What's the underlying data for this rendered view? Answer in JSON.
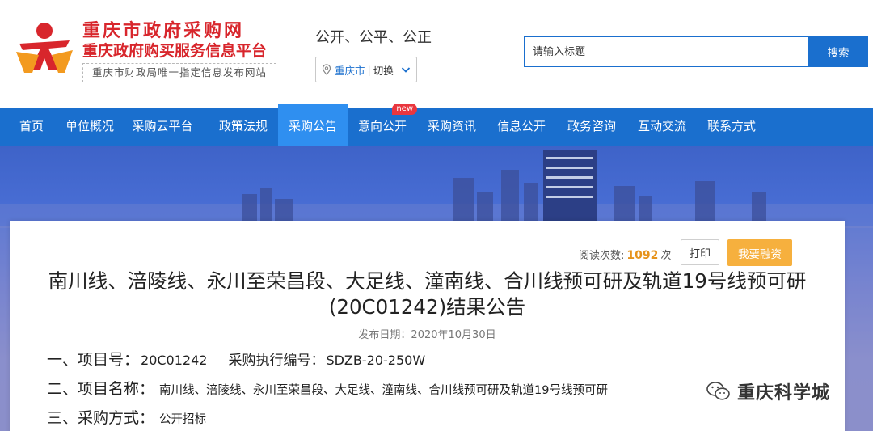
{
  "header": {
    "site_title": "重庆市政府采购网",
    "site_subtitle": "重庆政府购买服务信息平台",
    "site_note": "重庆市财政局唯一指定信息发布网站",
    "slogan": "公开、公平、公正",
    "city": "重庆市",
    "city_separator": "|",
    "switch_label": "切换",
    "search_placeholder": "请输入标题",
    "search_button": "搜索"
  },
  "nav": {
    "items": [
      {
        "label": "首页"
      },
      {
        "label": "单位概况"
      },
      {
        "label": "采购云平台"
      },
      {
        "label": "政策法规"
      },
      {
        "label": "采购公告"
      },
      {
        "label": "意向公开"
      },
      {
        "label": "采购资讯"
      },
      {
        "label": "信息公开"
      },
      {
        "label": "政务咨询"
      },
      {
        "label": "互动交流"
      },
      {
        "label": "联系方式"
      }
    ],
    "active_index": 4,
    "new_badge": "new"
  },
  "article": {
    "read_label": "阅读次数:",
    "read_count": "1092",
    "read_unit": "次",
    "print_button": "打印",
    "finance_button": "我要融资",
    "title": "南川线、涪陵线、永川至荣昌段、大足线、潼南线、合川线预可研及轨道19号线预可研(20C01242)结果公告",
    "publish_label": "发布日期：",
    "publish_date": "2020年10月30日",
    "rows": [
      {
        "key": "一、项目号：",
        "value": "20C01242",
        "key2": "采购执行编号：",
        "value2": "SDZB-20-250W"
      },
      {
        "key": "二、项目名称：",
        "value": "南川线、涪陵线、永川至荣昌段、大足线、潼南线、合川线预可研及轨道19号线预可研"
      },
      {
        "key": "三、采购方式：",
        "value": "公开招标"
      }
    ]
  },
  "watermark": {
    "text": "重庆科学城"
  },
  "colors": {
    "brand_red": "#d8262c",
    "nav_blue": "#1a6fce",
    "active_blue": "#2f8ff0",
    "finance_orange": "#f6b03e",
    "count_orange": "#e6931c"
  }
}
